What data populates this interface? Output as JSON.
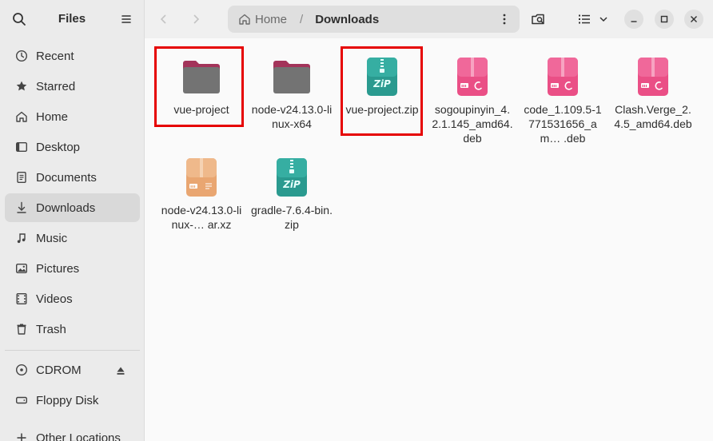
{
  "app": {
    "title": "Files"
  },
  "sidebar": {
    "items": [
      {
        "label": "Recent",
        "icon": "clock-icon"
      },
      {
        "label": "Starred",
        "icon": "star-icon"
      },
      {
        "label": "Home",
        "icon": "home-icon"
      },
      {
        "label": "Desktop",
        "icon": "desktop-icon"
      },
      {
        "label": "Documents",
        "icon": "document-icon"
      },
      {
        "label": "Downloads",
        "icon": "download-icon",
        "active": true
      },
      {
        "label": "Music",
        "icon": "music-icon"
      },
      {
        "label": "Pictures",
        "icon": "picture-icon"
      },
      {
        "label": "Videos",
        "icon": "video-icon"
      },
      {
        "label": "Trash",
        "icon": "trash-icon"
      }
    ],
    "devices": [
      {
        "label": "CDROM",
        "icon": "disc-icon",
        "ejectable": true
      },
      {
        "label": "Floppy Disk",
        "icon": "drive-icon"
      },
      {
        "label": "Other Locations",
        "icon": "plus-icon"
      }
    ]
  },
  "pathbar": {
    "home_label": "Home",
    "separator": "/",
    "current": "Downloads"
  },
  "files": [
    {
      "name": "vue-project",
      "kind": "folder",
      "highlighted": true
    },
    {
      "name": "node-v24.13.0-linux-x64",
      "kind": "folder"
    },
    {
      "name": "vue-project.zip",
      "kind": "zip",
      "highlighted": true
    },
    {
      "name": "sogoupinyin_4.2.1.145_amd64.deb",
      "kind": "deb"
    },
    {
      "name": "code_1.109.5-1771531656_am… .deb",
      "kind": "deb"
    },
    {
      "name": "Clash.Verge_2.4.5_amd64.deb",
      "kind": "deb"
    },
    {
      "name": "node-v24.13.0-linux-… ar.xz",
      "kind": "archive"
    },
    {
      "name": "gradle-7.6.4-bin.zip",
      "kind": "zip"
    }
  ],
  "colors": {
    "highlight": "#e60000",
    "folder_body": "#737373",
    "folder_tab": "#a3345a",
    "zip": "#2a9a8f",
    "deb": "#ea4f86",
    "archive": "#e9a671"
  }
}
